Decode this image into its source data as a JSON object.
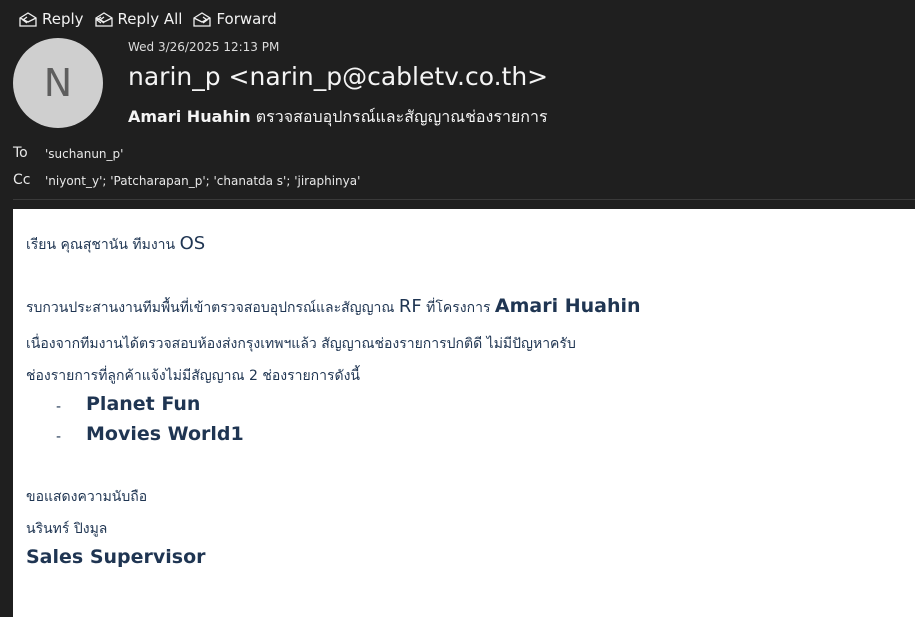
{
  "toolbar": {
    "reply": "Reply",
    "reply_all": "Reply All",
    "forward": "Forward"
  },
  "header": {
    "avatar_initial": "N",
    "datetime": "Wed 3/26/2025 12:13 PM",
    "sender": "narin_p <narin_p@cabletv.co.th>",
    "subject_bold": "Amari Huahin",
    "subject_rest": " ตรวจสอบอุปกรณ์และสัญญาณช่องรายการ"
  },
  "recipients": {
    "to_label": "To",
    "to_value": "'suchanun_p'",
    "cc_label": "Cc",
    "cc_value": "'niyont_y'; 'Patcharapan_p'; 'chanatda s'; 'jiraphinya'"
  },
  "body": {
    "greeting_text": "เรียน คุณสุชานัน ทีมงาน ",
    "greeting_os": "OS",
    "line1_text": "รบกวนประสานงานทีมพื้นที่เข้าตรวจสอบอุปกรณ์และสัญญาณ ",
    "line1_rf": "RF",
    "line1_mid": " ที่โครงการ ",
    "line1_project": "Amari Huahin",
    "line2": "เนื่องจากทีมงานได้ตรวจสอบห้องส่งกรุงเทพฯแล้ว สัญญาณช่องรายการปกติดี ไม่มีปัญหาครับ",
    "line3": "ช่องรายการที่ลูกค้าแจ้งไม่มีสัญญาณ 2 ช่องรายการดังนี้",
    "bullet_marker": "-",
    "channels": [
      "Planet Fun",
      "Movies World1"
    ],
    "closing": "ขอแสดงความนับถือ",
    "sig_name": "นรินทร์ ปิงมูล",
    "sig_title": "Sales Supervisor"
  }
}
